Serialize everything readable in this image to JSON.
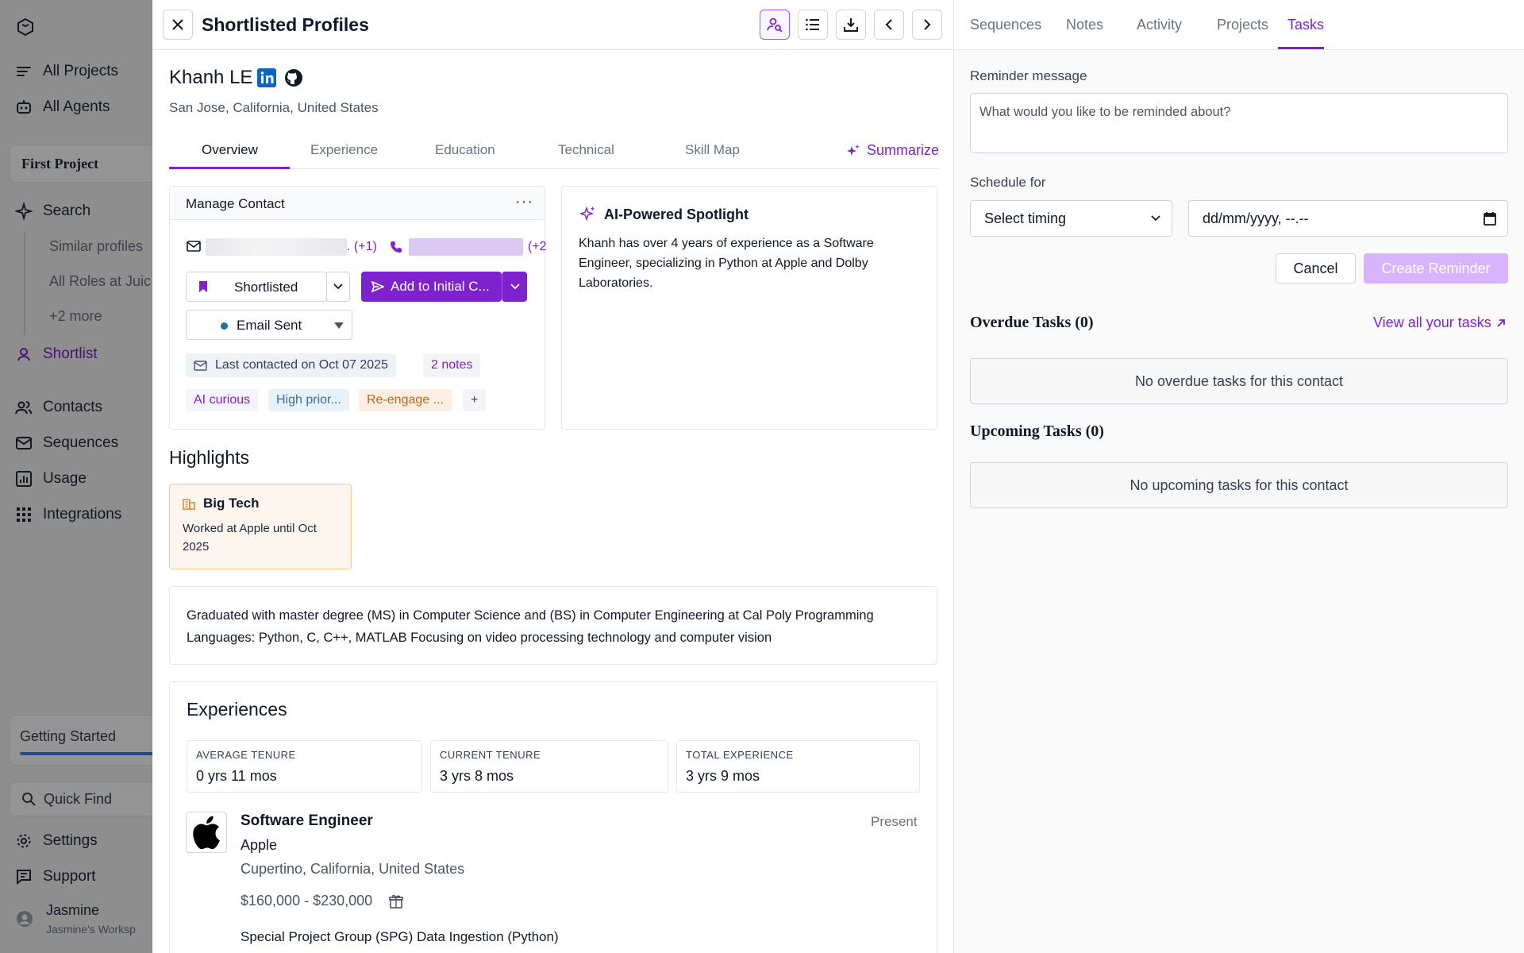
{
  "sidebar": {
    "items": [
      {
        "label": "All Projects",
        "icon": "lines-icon"
      },
      {
        "label": "All Agents",
        "icon": "robot-icon"
      }
    ],
    "project_name": "First Project",
    "search_label": "Search",
    "sub_items": [
      "Similar profiles",
      "All Roles at Juic",
      "+2 more"
    ],
    "shortlist_label": "Shortlist",
    "nav": [
      {
        "label": "Contacts",
        "icon": "users-icon"
      },
      {
        "label": "Sequences",
        "icon": "mail-icon"
      },
      {
        "label": "Usage",
        "icon": "chart-icon"
      },
      {
        "label": "Integrations",
        "icon": "grid-icon"
      }
    ],
    "getting_started": "Getting Started",
    "quick_find": "Quick Find",
    "settings": "Settings",
    "support": "Support",
    "user_name": "Jasmine",
    "user_workspace": "Jasmine's Worksp"
  },
  "header": {
    "title": "Shortlisted Profiles"
  },
  "profile": {
    "name": "Khanh LE",
    "location": "San Jose, California, United States"
  },
  "tabs": [
    "Overview",
    "Experience",
    "Education",
    "Technical",
    "Skill Map"
  ],
  "summarize_label": "Summarize",
  "manage_contact": {
    "title": "Manage Contact",
    "email_suffix": ". (+1)",
    "phone_suffix": "(+2",
    "status_label": "Shortlisted",
    "sequence_button": "Add to Initial C...",
    "email_status": "Email Sent",
    "last_contacted": "Last contacted on Oct 07 2025",
    "notes": "2 notes",
    "tags": [
      "AI curious",
      "High prior...",
      "Re-engage ...",
      "+"
    ]
  },
  "spotlight": {
    "title": "AI-Powered Spotlight",
    "text": "Khanh has over 4 years of experience as a Software Engineer, specializing in Python at Apple and Dolby Laboratories."
  },
  "highlights": {
    "title": "Highlights",
    "card_title": "Big Tech",
    "card_text": "Worked at Apple until Oct 2025"
  },
  "summary": "Graduated with master degree (MS) in Computer Science and (BS) in Computer Engineering at Cal Poly Programming Languages: Python, C, C++, MATLAB Focusing on video processing technology and computer vision",
  "experiences": {
    "title": "Experiences",
    "stats": [
      {
        "label": "AVERAGE TENURE",
        "value": "0 yrs 11 mos"
      },
      {
        "label": "CURRENT TENURE",
        "value": "3 yrs 8 mos"
      },
      {
        "label": "TOTAL EXPERIENCE",
        "value": "3 yrs 9 mos"
      }
    ],
    "job": {
      "title": "Software Engineer",
      "company": "Apple",
      "location": "Cupertino, California, United States",
      "salary": "$160,000 - $230,000",
      "period": "Present",
      "project": "Special Project Group (SPG) Data Ingestion (Python)"
    }
  },
  "right_panel": {
    "tabs": [
      "Sequences",
      "Notes",
      "Activity",
      "Projects",
      "Tasks"
    ],
    "active_tab": "Tasks",
    "reminder_label": "Reminder message",
    "reminder_placeholder": "What would you like to be reminded about?",
    "schedule_label": "Schedule for",
    "timing_value": "Select timing",
    "datetime_placeholder": "dd/mm/yyyy, --.--",
    "cancel": "Cancel",
    "create": "Create Reminder",
    "overdue_title": "Overdue Tasks (0)",
    "view_all": "View all your tasks",
    "overdue_empty": "No overdue tasks for this contact",
    "upcoming_title": "Upcoming Tasks (0)",
    "upcoming_empty": "No upcoming tasks for this contact"
  },
  "colors": {
    "accent": "#7e22ce",
    "accent_light": "#d8b4fe",
    "overlay": "rgba(0,0,0,0.42)"
  }
}
